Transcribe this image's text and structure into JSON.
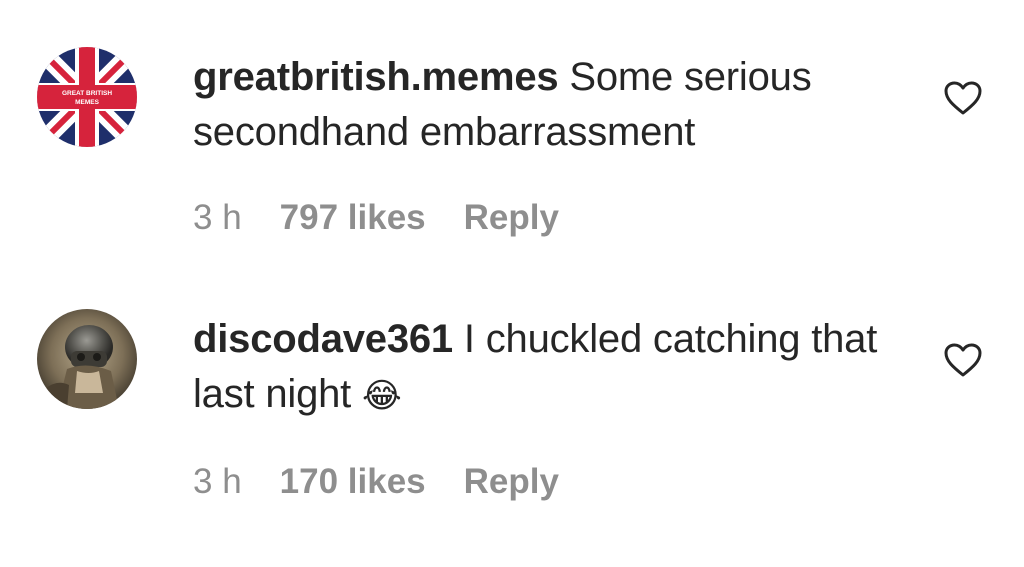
{
  "comments": [
    {
      "username": "greatbritish.memes",
      "text": "Some serious secondhand embarrassment",
      "time": "3 h",
      "likes": "797 likes",
      "reply_label": "Reply",
      "avatar_text_line1": "GREAT BRITISH",
      "avatar_text_line2": "MEMES",
      "emoji": ""
    },
    {
      "username": "discodave361",
      "text": "I chuckled catching that last night",
      "time": "3 h",
      "likes": "170 likes",
      "reply_label": "Reply",
      "emoji": "😂"
    }
  ],
  "icons": {
    "like": "heart-outline-icon"
  },
  "colors": {
    "text": "#262626",
    "secondary": "#8e8e8e",
    "flag_blue": "#1f2f6b",
    "flag_red": "#d6233c"
  }
}
